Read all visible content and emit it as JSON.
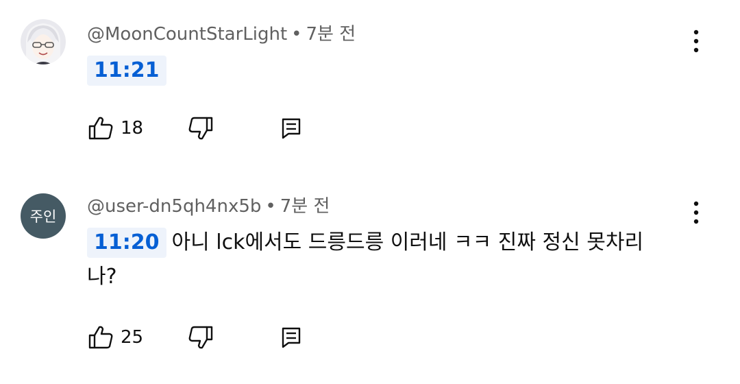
{
  "comments": [
    {
      "author": "@MoonCountStarLight",
      "separator": "•",
      "time_ago": "7분 전",
      "timestamp_link": "11:21",
      "text": "",
      "like_count": "18",
      "avatar": {
        "kind": "image",
        "icon": "anime-character-avatar"
      }
    },
    {
      "author": "@user-dn5qh4nx5b",
      "separator": "•",
      "time_ago": "7분 전",
      "timestamp_link": "11:20",
      "text": "아니 lck에서도 드릉드릉 이러네 ㅋㅋ 진짜 정신 못차리나?",
      "like_count": "25",
      "avatar": {
        "kind": "initials",
        "initials": "주인",
        "color": "#455a64"
      }
    }
  ],
  "icons": {
    "like": "thumbs-up-icon",
    "dislike": "thumbs-down-icon",
    "reply": "reply-icon",
    "menu": "more-vert-icon"
  },
  "colors": {
    "timestamp_link": "#065fd4",
    "timestamp_bg": "#eef3fb",
    "meta_text": "#606060"
  }
}
